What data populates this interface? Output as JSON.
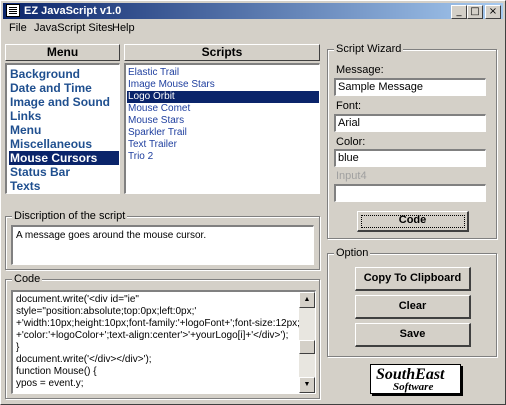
{
  "window": {
    "title": "EZ JavaScript v1.0"
  },
  "menubar": {
    "items": [
      "File",
      "JavaScript Sites",
      "Help"
    ]
  },
  "menu_list": {
    "header": "Menu",
    "items": [
      "Background",
      "Date and Time",
      "Image and Sound",
      "Links",
      "Menu",
      "Miscellaneous",
      "Mouse Cursors",
      "Status Bar",
      "Texts"
    ],
    "selected": "Mouse Cursors"
  },
  "scripts_list": {
    "header": "Scripts",
    "items": [
      "Elastic Trail",
      "Image Mouse Stars",
      "Logo Orbit",
      "Mouse Comet",
      "Mouse Stars",
      "Sparkler Trail",
      "Text Trailer",
      "Trio 2"
    ],
    "selected": "Logo Orbit"
  },
  "description": {
    "legend": "Discription of the script",
    "text": "A message goes around the mouse cursor."
  },
  "code": {
    "legend": "Code",
    "lines": [
      "document.write('<div id=\"ie\"",
      "style=\"position:absolute;top:0px;left:0px;'",
      "+'width:10px;height:10px;font-family:'+logoFont+';font-size:12px;'",
      "+'color:'+logoColor+';text-align:center'>'+yourLogo[i]+'</div>');",
      "}",
      "document.write('</div></div>');",
      "function Mouse() {",
      "ypos = event.y;"
    ]
  },
  "wizard": {
    "legend": "Script Wizard",
    "fields": [
      {
        "label": "Message:",
        "value": "Sample Message",
        "disabled": false
      },
      {
        "label": "Font:",
        "value": "Arial",
        "disabled": false
      },
      {
        "label": "Color:",
        "value": "blue",
        "disabled": false
      },
      {
        "label": "Input4",
        "value": "",
        "disabled": true
      }
    ],
    "code_button": "Code"
  },
  "option": {
    "legend": "Option",
    "copy_button": "Copy To Clipboard",
    "clear_button": "Clear",
    "save_button": "Save"
  },
  "logo": {
    "line1": "SouthEast",
    "line2": "Software"
  },
  "colors": {
    "title_start": "#0a246a",
    "title_end": "#a6caf0",
    "selection": "#0a246a",
    "list_text": "#1f4f8f",
    "face": "#d4d0c8"
  }
}
